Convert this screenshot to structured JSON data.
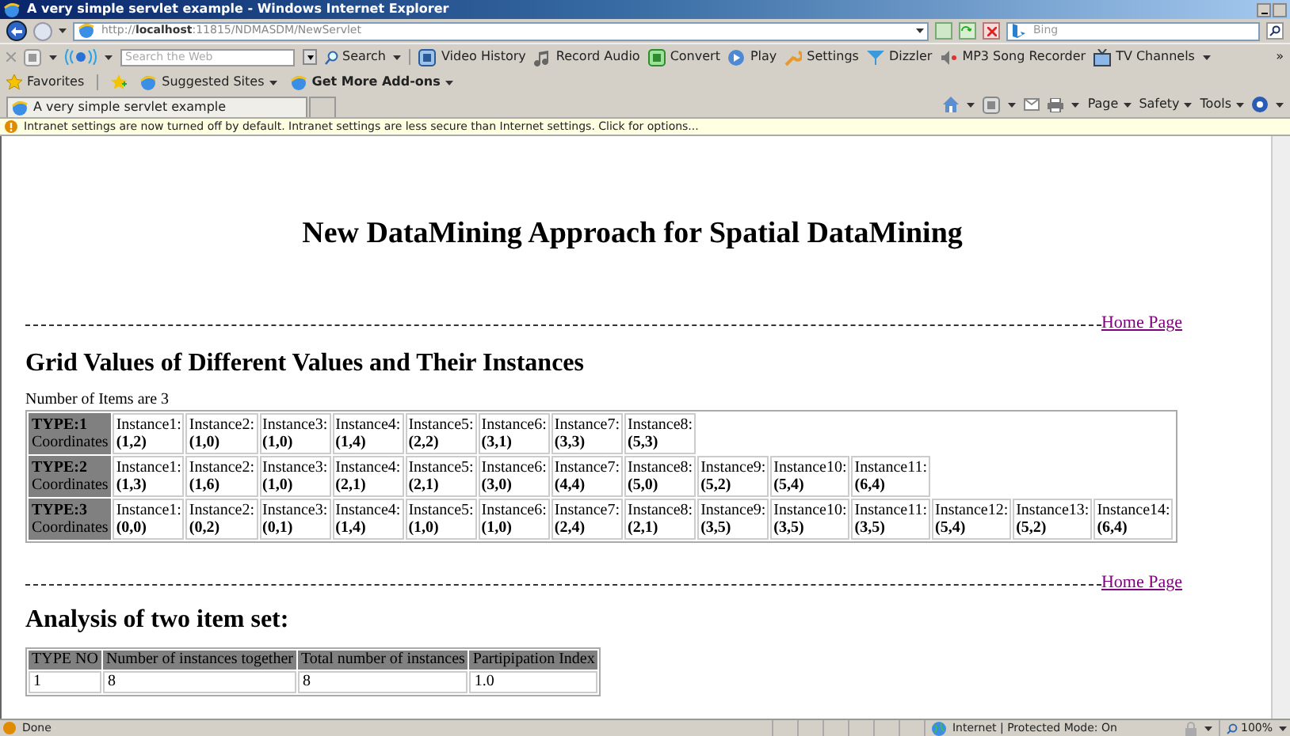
{
  "window": {
    "title": "A very simple servlet example - Windows Internet Explorer"
  },
  "address_bar": {
    "url_prefix": "http://",
    "url_host": "localhost",
    "url_rest": ":11815/NDMASDM/NewServlet",
    "search_placeholder": "Bing"
  },
  "toolbar": {
    "search_placeholder": "Search the Web",
    "search_button": "Search",
    "items": [
      {
        "label": "Video History"
      },
      {
        "label": "Record Audio"
      },
      {
        "label": "Convert"
      },
      {
        "label": "Play"
      },
      {
        "label": "Settings"
      },
      {
        "label": "Dizzler"
      },
      {
        "label": "MP3 Song Recorder"
      },
      {
        "label": "TV Channels"
      }
    ],
    "more": "»"
  },
  "favorites_bar": {
    "favorites": "Favorites",
    "items": [
      {
        "label": "Suggested Sites",
        "bold": false
      },
      {
        "label": "Get More Add-ons",
        "bold": true
      }
    ]
  },
  "tab": {
    "title": "A very simple servlet example"
  },
  "command_bar": {
    "items": [
      "Page",
      "Safety",
      "Tools"
    ]
  },
  "info_bar": {
    "text": "Intranet settings are now turned off by default. Intranet settings are less secure than Internet settings. Click for options..."
  },
  "page": {
    "title": "New DataMining Approach for Spatial DataMining",
    "home_link_1": "Home Page",
    "grid_heading": "Grid Values of Different Values and Their Instances",
    "items_count": "Number of Items are 3",
    "grid_rows": [
      {
        "type": "TYPE:1",
        "coords_label": "Coordinates",
        "instances": [
          [
            "Instance1:",
            "(1,2)"
          ],
          [
            "Instance2:",
            "(1,0)"
          ],
          [
            "Instance3:",
            "(1,0)"
          ],
          [
            "Instance4:",
            "(1,4)"
          ],
          [
            "Instance5:",
            "(2,2)"
          ],
          [
            "Instance6:",
            "(3,1)"
          ],
          [
            "Instance7:",
            "(3,3)"
          ],
          [
            "Instance8:",
            "(5,3)"
          ]
        ]
      },
      {
        "type": "TYPE:2",
        "coords_label": "Coordinates",
        "instances": [
          [
            "Instance1:",
            "(1,3)"
          ],
          [
            "Instance2:",
            "(1,6)"
          ],
          [
            "Instance3:",
            "(1,0)"
          ],
          [
            "Instance4:",
            "(2,1)"
          ],
          [
            "Instance5:",
            "(2,1)"
          ],
          [
            "Instance6:",
            "(3,0)"
          ],
          [
            "Instance7:",
            "(4,4)"
          ],
          [
            "Instance8:",
            "(5,0)"
          ],
          [
            "Instance9:",
            "(5,2)"
          ],
          [
            "Instance10:",
            "(5,4)"
          ],
          [
            "Instance11:",
            "(6,4)"
          ]
        ]
      },
      {
        "type": "TYPE:3",
        "coords_label": "Coordinates",
        "instances": [
          [
            "Instance1:",
            "(0,0)"
          ],
          [
            "Instance2:",
            "(0,2)"
          ],
          [
            "Instance3:",
            "(0,1)"
          ],
          [
            "Instance4:",
            "(1,4)"
          ],
          [
            "Instance5:",
            "(1,0)"
          ],
          [
            "Instance6:",
            "(1,0)"
          ],
          [
            "Instance7:",
            "(2,4)"
          ],
          [
            "Instance8:",
            "(2,1)"
          ],
          [
            "Instance9:",
            "(3,5)"
          ],
          [
            "Instance10:",
            "(3,5)"
          ],
          [
            "Instance11:",
            "(3,5)"
          ],
          [
            "Instance12:",
            "(5,4)"
          ],
          [
            "Instance13:",
            "(5,2)"
          ],
          [
            "Instance14:",
            "(6,4)"
          ]
        ]
      }
    ],
    "home_link_2": "Home Page",
    "analysis_heading": "Analysis of two item set:",
    "analysis_tables": [
      {
        "columns": [
          "TYPE NO",
          "Number of instances together",
          "Total number of instances",
          "Partipipation Index"
        ],
        "rows": [
          [
            "1",
            "8",
            "8",
            "1.0"
          ]
        ]
      }
    ]
  },
  "status_bar": {
    "text": "Done",
    "zone": "Internet | Protected Mode: On",
    "zoom": "100%"
  }
}
